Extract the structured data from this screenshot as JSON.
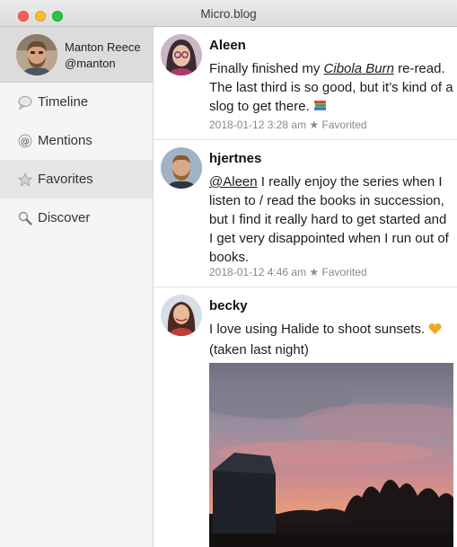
{
  "window": {
    "title": "Micro.blog"
  },
  "profile": {
    "name": "Manton Reece",
    "handle": "@manton",
    "avatar_icon": "user-avatar"
  },
  "sidebar": {
    "items": [
      {
        "label": "Timeline",
        "icon": "speech-bubble-icon",
        "selected": false
      },
      {
        "label": "Mentions",
        "icon": "at-sign-icon",
        "selected": false
      },
      {
        "label": "Favorites",
        "icon": "star-icon",
        "selected": true
      },
      {
        "label": "Discover",
        "icon": "magnifier-icon",
        "selected": false
      }
    ]
  },
  "posts": [
    {
      "user": "Aleen",
      "text_before": "Finally finished my ",
      "link": "Cibola Burn",
      "text_after": " re-read. The last third is so good, but it’s kind of a slog to get there.",
      "emoji": "books-emoji",
      "date": "2018-01-12 3:28 am",
      "favorited": "Favorited"
    },
    {
      "user": "hjertnes",
      "mention": "@Aleen",
      "text": " I really enjoy the series when I listen to / read the books in succession, but I find it really hard to get started and I get very disappointed when I run out of books.",
      "date": "2018-01-12 4:46 am",
      "favorited": "Favorited"
    },
    {
      "user": "becky",
      "text": "I love using Halide to shoot sunsets.",
      "emoji": "orange-heart-emoji",
      "text_line2": "(taken last night)",
      "image": "sunset-photo"
    }
  ],
  "colors": {
    "close": "#fc5f57",
    "minimize": "#fdbc2e",
    "maximize": "#29c840",
    "selected_row": "#e6e6e6",
    "heart": "#f4a623"
  }
}
